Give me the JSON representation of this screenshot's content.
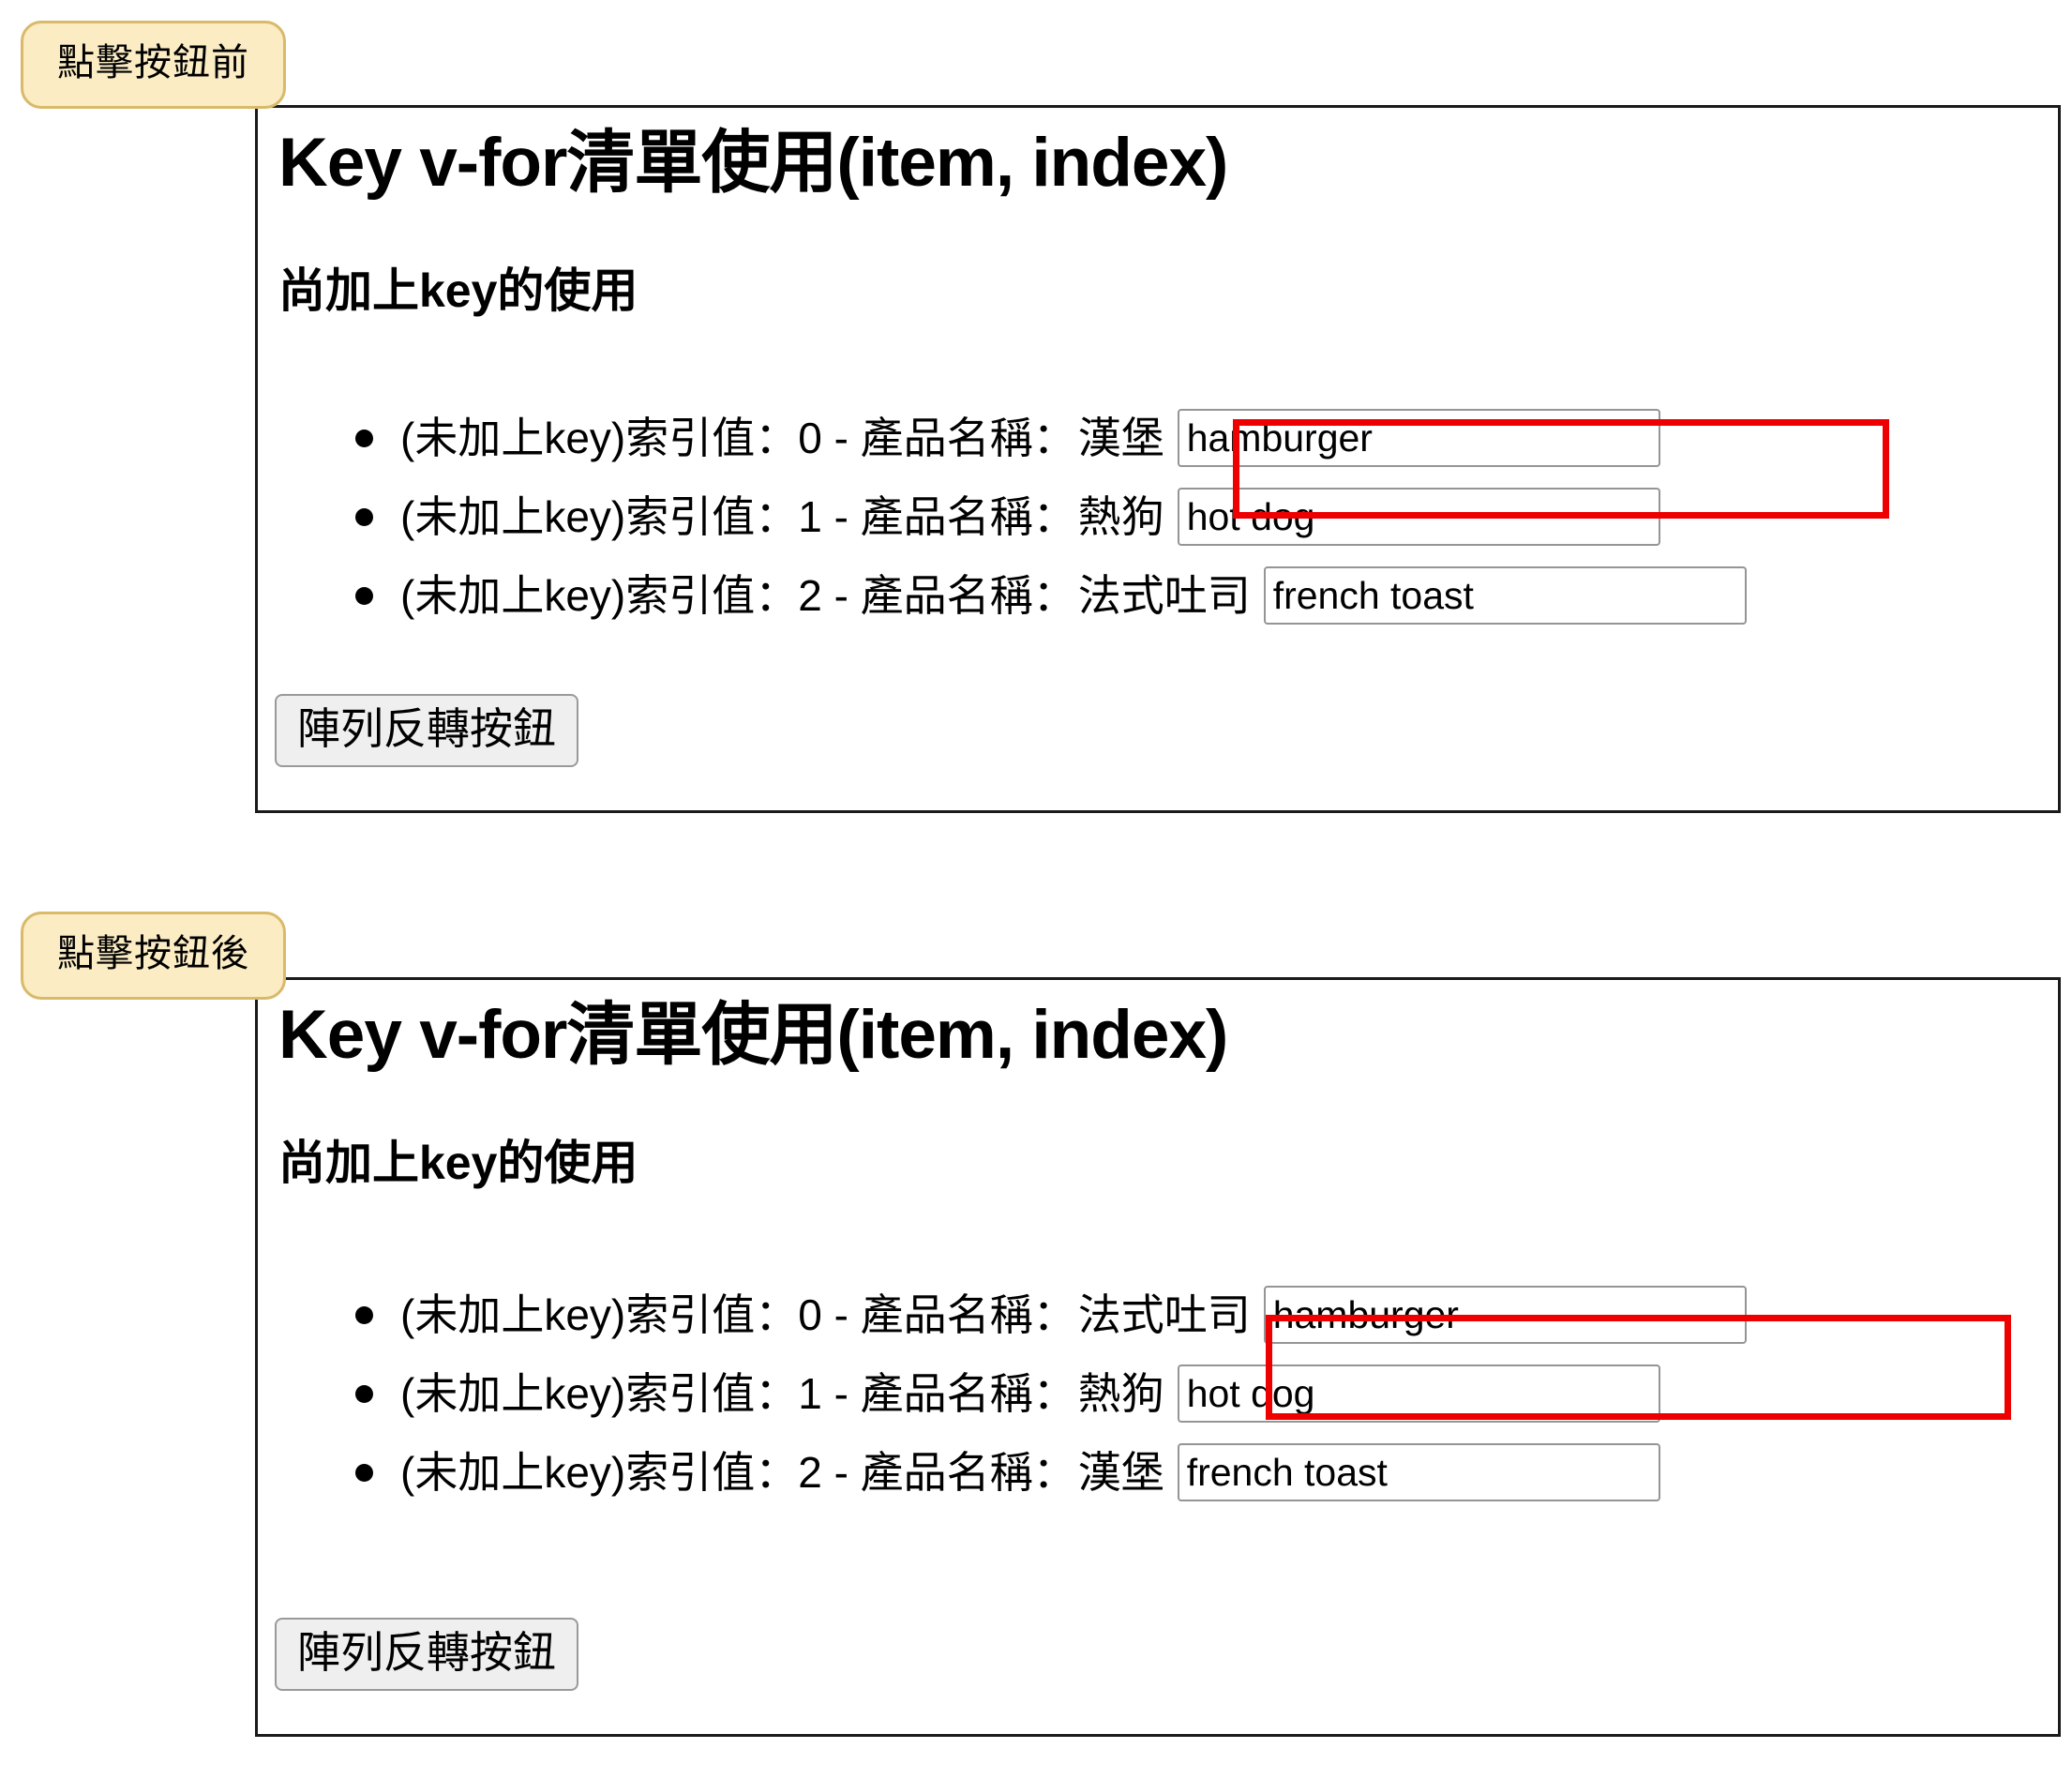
{
  "annotations": {
    "before": "點擊按鈕前",
    "after": "點擊按鈕後"
  },
  "colors": {
    "badge_background": "#fbecc4",
    "badge_border": "#d9b96a",
    "highlight_border": "#ee0000",
    "panel_border": "#1a1a1a",
    "button_background": "#efefef",
    "input_border": "#959595"
  },
  "panels": [
    {
      "state": "before",
      "title": "Key v-for清單使用(item, index)",
      "subtitle": "尚加上key的使用",
      "items": [
        {
          "prefix": "(未加上key)索引值：0 - 產品名稱：",
          "name": "漢堡",
          "input_value": "hamburger",
          "highlighted": "true"
        },
        {
          "prefix": "(未加上key)索引值：1 - 產品名稱：",
          "name": "熱狗",
          "input_value": "hot dog",
          "highlighted": "false"
        },
        {
          "prefix": "(未加上key)索引值：2 - 產品名稱：",
          "name": "法式吐司",
          "input_value": "french toast",
          "highlighted": "false"
        }
      ],
      "button_label": "陣列反轉按鈕"
    },
    {
      "state": "after",
      "title": "Key v-for清單使用(item, index)",
      "subtitle": "尚加上key的使用",
      "items": [
        {
          "prefix": "(未加上key)索引值：0 - 產品名稱：",
          "name": "法式吐司",
          "input_value": "hamburger",
          "highlighted": "true"
        },
        {
          "prefix": "(未加上key)索引值：1 - 產品名稱：",
          "name": "熱狗",
          "input_value": "hot dog",
          "highlighted": "false"
        },
        {
          "prefix": "(未加上key)索引值：2 - 產品名稱：",
          "name": "漢堡",
          "input_value": "french toast",
          "highlighted": "false"
        }
      ],
      "button_label": "陣列反轉按鈕"
    }
  ]
}
